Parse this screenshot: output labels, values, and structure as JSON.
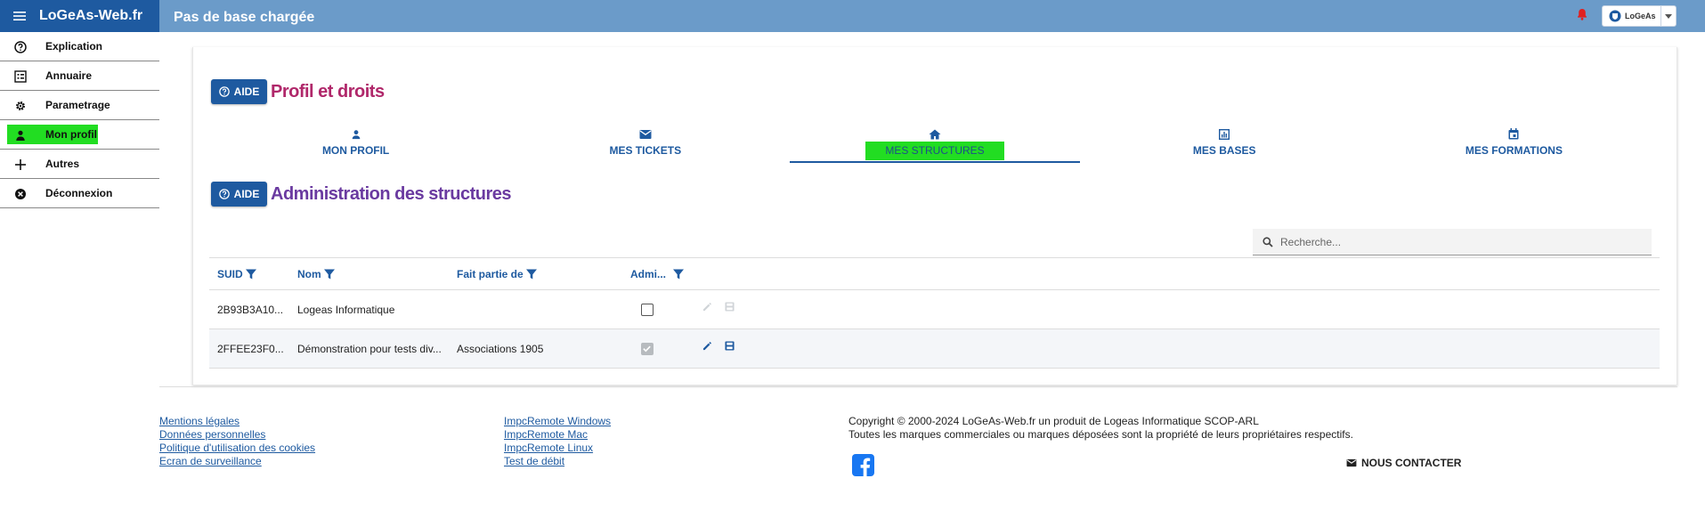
{
  "header": {
    "brand": "LoGeAs-Web.fr",
    "status": "Pas de base chargée",
    "account_name": "LoGeAs"
  },
  "sidebar": {
    "items": [
      {
        "label": "Explication",
        "icon": "help-circle-icon"
      },
      {
        "label": "Annuaire",
        "icon": "list-icon"
      },
      {
        "label": "Parametrage",
        "icon": "gear-icon"
      },
      {
        "label": "Mon profil",
        "icon": "person-icon",
        "active": true
      },
      {
        "label": "Autres",
        "icon": "plus-icon"
      },
      {
        "label": "Déconnexion",
        "icon": "close-circle-icon"
      }
    ]
  },
  "main": {
    "aide_label": "AIDE",
    "profile_title": "Profil et droits",
    "tabs": [
      {
        "label": "MON PROFIL",
        "icon": "person-icon"
      },
      {
        "label": "MES TICKETS",
        "icon": "mail-icon"
      },
      {
        "label": "MES STRUCTURES",
        "icon": "home-icon",
        "active": true
      },
      {
        "label": "MES BASES",
        "icon": "chart-icon"
      },
      {
        "label": "MES FORMATIONS",
        "icon": "calendar-icon"
      }
    ],
    "admin_title": "Administration des structures",
    "search_placeholder": "Recherche...",
    "columns": [
      "SUID",
      "Nom",
      "Fait partie de",
      "Admi..."
    ],
    "rows": [
      {
        "suid": "2B93B3A10...",
        "nom": "Logeas Informatique",
        "parent": "",
        "admin": false
      },
      {
        "suid": "2FFEE23F0...",
        "nom": "Démonstration pour tests div...",
        "parent": "Associations 1905",
        "admin": true
      }
    ]
  },
  "footer": {
    "links_col1": [
      "Mentions légales",
      "Données personnelles",
      "Politique d'utilisation des cookies",
      "Ecran de surveillance"
    ],
    "links_col2": [
      "ImpcRemote Windows",
      "ImpcRemote Mac",
      "ImpcRemote Linux",
      "Test de débit"
    ],
    "copyright_line1": "Copyright © 2000-2024 LoGeAs-Web.fr un produit de Logeas Informatique SCOP-ARL",
    "copyright_line2": "Toutes les marques commerciales ou marques déposées sont la propriété de leurs propriétaires respectifs.",
    "contact": "NOUS CONTACTER"
  },
  "colors": {
    "brand_blue": "#1e5aa0",
    "topbar": "#6b9bc9",
    "highlight_green": "#22dd22",
    "profile_title": "#b0276a",
    "admin_title": "#6a3aa0",
    "bell_red": "#e02020"
  }
}
